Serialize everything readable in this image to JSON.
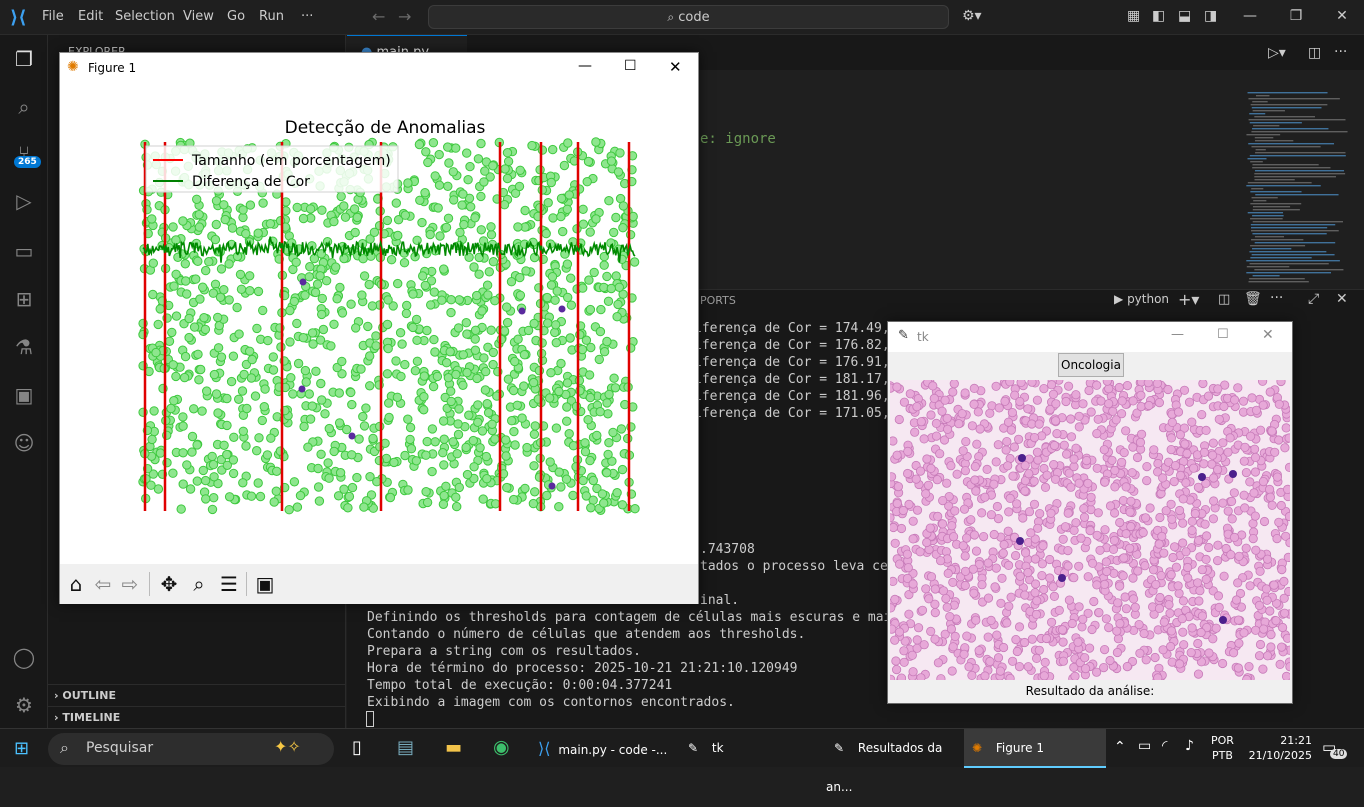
{
  "vscode": {
    "menu": [
      "File",
      "Edit",
      "Selection",
      "View",
      "Go",
      "Run",
      "···"
    ],
    "search_text": "code",
    "activity_badge": "265",
    "sidebar_header": "EXPLORER",
    "outline_label": "OUTLINE",
    "timeline_label": "TIMELINE",
    "tab_label": "main.py",
    "code_fragment": "e: ignore",
    "panel_tab_fragment": "PORTS",
    "terminal_name": "python",
    "terminal_lines_partial": [
      "iferença de Cor = 174.49, Me",
      "iferença de Cor = 176.82, Acu",
      "iferença de Cor = 176.91, Acu",
      "iferença de Cor = 181.17, Me",
      "iferença de Cor = 181.96, Me",
      "iferença de Cor = 171.05, Me",
      ".743708",
      "tados o processo leva cerca",
      "inal."
    ],
    "terminal_lines": [
      "Definindo os thresholds para contagem de células mais escuras e maiores.",
      "Contando o número de células que atendem aos thresholds.",
      "Prepara a string com os resultados.",
      "Hora de término do processo: 2025-10-21 21:21:10.120949",
      "Tempo total de execução: 0:00:04.377241",
      "Exibindo a imagem com os contornos encontrados."
    ]
  },
  "figure": {
    "window_title": "Figure 1",
    "toolbar_icons": [
      "home-icon",
      "back-icon",
      "forward-icon",
      "pan-icon",
      "zoom-icon",
      "configure-icon",
      "save-icon"
    ]
  },
  "chart_data": {
    "type": "line",
    "title": "Detecção de Anomalias",
    "legend_position": "top-left",
    "series": [
      {
        "name": "Tamanho (em porcentagem)",
        "color": "#ff0000"
      },
      {
        "name": "Diferença de Cor",
        "color": "#008000"
      }
    ],
    "grid": false
  },
  "tk": {
    "window_title": "tk",
    "button_label": "Oncologia",
    "result_label": "Resultado da análise:"
  },
  "taskbar": {
    "search_placeholder": "Pesquisar",
    "apps": [
      "main.py - code -...",
      "tk",
      "Resultados da an...",
      "Figure 1"
    ],
    "lang_top": "POR",
    "lang_bottom": "PTB",
    "time": "21:21",
    "date": "21/10/2025",
    "notification_count": "40"
  },
  "colors": {
    "vscode_bg": "#1f1f1f",
    "accent": "#0078d4",
    "red_line": "#ff0000",
    "green_line": "#008000",
    "cell_green": "#7ee07e"
  }
}
